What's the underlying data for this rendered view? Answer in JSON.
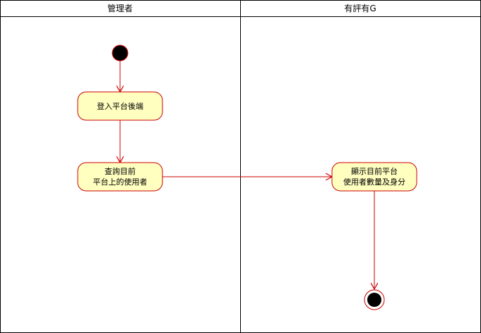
{
  "diagram": {
    "type": "uml-activity-swimlane",
    "lanes": [
      {
        "id": "lane-admin",
        "title": "管理者"
      },
      {
        "id": "lane-system",
        "title": "有評有G"
      }
    ],
    "nodes": [
      {
        "id": "start",
        "kind": "initial",
        "lane": "lane-admin"
      },
      {
        "id": "login",
        "kind": "action",
        "lane": "lane-admin",
        "lines": [
          "登入平台後端"
        ]
      },
      {
        "id": "query",
        "kind": "action",
        "lane": "lane-admin",
        "lines": [
          "查詢目前",
          "平台上的使用者"
        ]
      },
      {
        "id": "display",
        "kind": "action",
        "lane": "lane-system",
        "lines": [
          "顯示目前平台",
          "使用者數量及身分"
        ]
      },
      {
        "id": "end",
        "kind": "final",
        "lane": "lane-system"
      }
    ],
    "edges": [
      {
        "from": "start",
        "to": "login"
      },
      {
        "from": "login",
        "to": "query"
      },
      {
        "from": "query",
        "to": "display"
      },
      {
        "from": "display",
        "to": "end"
      }
    ]
  },
  "colors": {
    "node_fill": "#ffffc0",
    "node_stroke": "#cc0000",
    "edge": "#cc0000",
    "initial_fill": "#000000",
    "lane_border": "#000000"
  }
}
